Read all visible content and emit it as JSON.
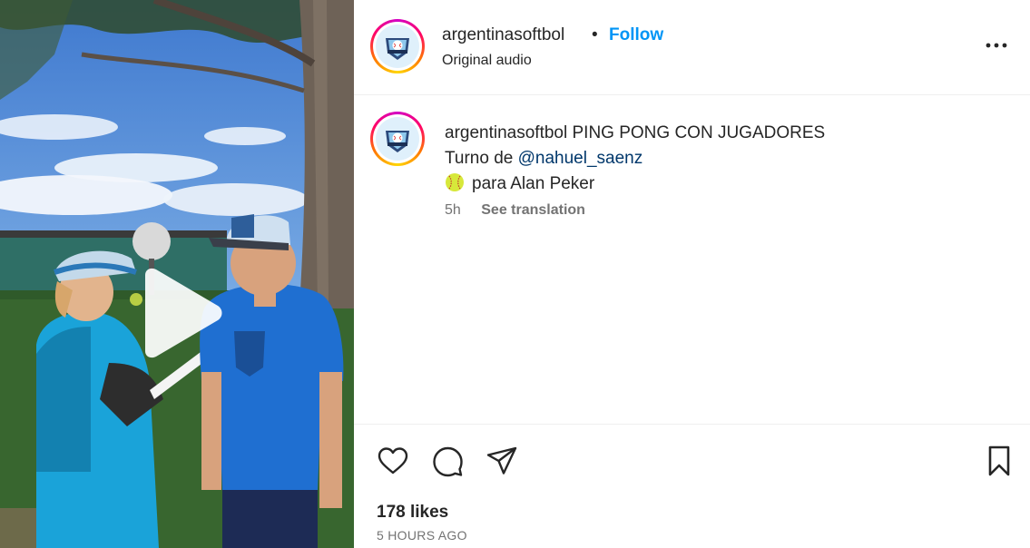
{
  "post": {
    "username": "argentinasoftbol",
    "separator": "•",
    "follow_label": "Follow",
    "audio_label": "Original audio",
    "more_icon": "more-horizontal-icon"
  },
  "caption": {
    "username": "argentinasoftbol",
    "line1": "PING PONG CON JUGADORES",
    "line2_prefix": "Turno de ",
    "mention": "@nahuel_saenz",
    "line3_emoji": "softball-emoji",
    "line3_text": "para Alan Peker",
    "time": "5h",
    "translate_label": "See translation"
  },
  "actions": {
    "like_icon": "heart-icon",
    "comment_icon": "comment-icon",
    "share_icon": "send-icon",
    "save_icon": "bookmark-icon"
  },
  "likes_text": "178 likes",
  "timestamp": "5 HOURS AGO",
  "colors": {
    "follow": "#0095f6",
    "mention": "#00376b",
    "secondary_text": "#737373"
  }
}
